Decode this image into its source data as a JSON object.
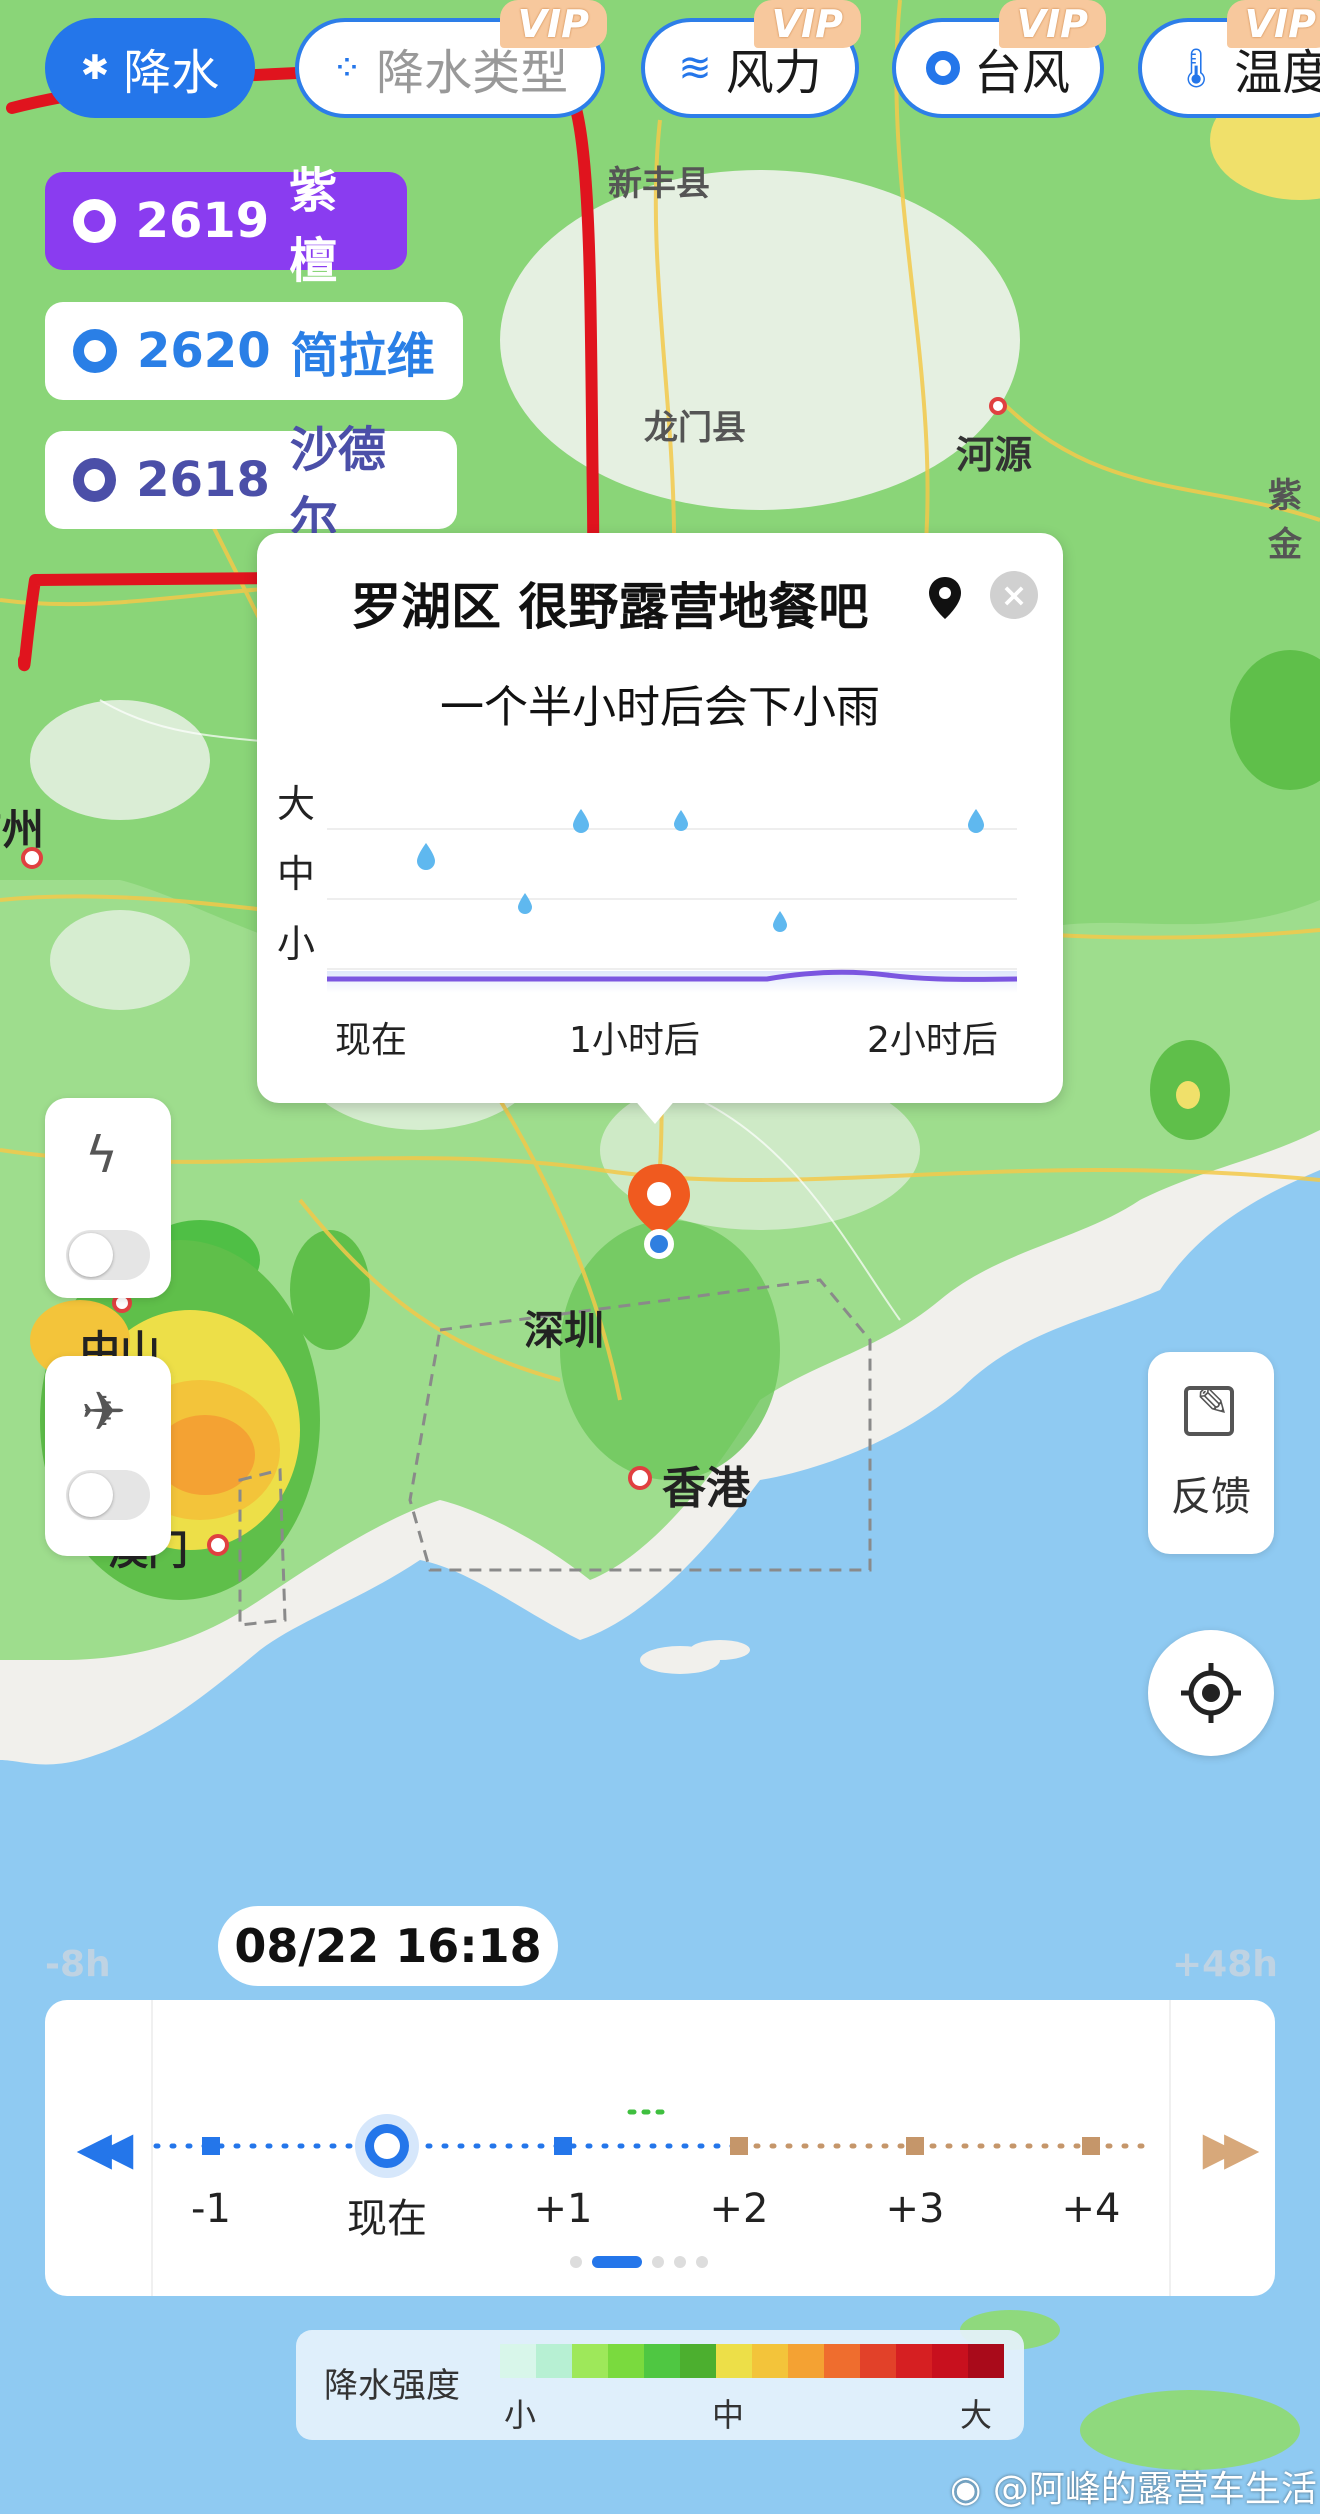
{
  "tabs": [
    {
      "label": "降水",
      "icon": "rain-icon",
      "active": true
    },
    {
      "label": "降水类型",
      "icon": "precip-type-icon",
      "vip": "VIP"
    },
    {
      "label": "风力",
      "icon": "wind-icon",
      "vip": "VIP"
    },
    {
      "label": "台风",
      "icon": "typhoon-icon",
      "vip": "VIP"
    },
    {
      "label": "温度",
      "icon": "thermometer-icon",
      "vip": "VIP"
    }
  ],
  "storms": [
    {
      "code": "2619",
      "name": "紫檀",
      "color": "#8a3cf0"
    },
    {
      "code": "2620",
      "name": "简拉维",
      "color": "#2a7fe6"
    },
    {
      "code": "2618",
      "name": "沙德尔",
      "color": "#4b4fa8"
    }
  ],
  "map_labels": {
    "xinfeng": "新丰县",
    "longmen": "龙门县",
    "heyuan": "河源",
    "zijin": "紫金",
    "guangzhou": "广州",
    "shenzhen": "深圳",
    "hongkong": "香港",
    "zhongshan": "中山",
    "macau": "澳门"
  },
  "popup": {
    "location": "罗湖区 很野露营地餐吧",
    "forecast": "一个半小时后会下小雨",
    "y_levels": [
      "大",
      "中",
      "小"
    ],
    "x_labels": [
      "现在",
      "1小时后",
      "2小时后"
    ]
  },
  "side": {
    "feedback_label": "反馈"
  },
  "timeline": {
    "current_time": "08/22 16:18",
    "range_start": "-8h",
    "range_end": "+48h",
    "ticks": [
      "-1",
      "现在",
      "+1",
      "+2",
      "+3",
      "+4"
    ],
    "page_index": 2,
    "page_count": 6
  },
  "legend": {
    "title": "降水强度",
    "low": "小",
    "mid": "中",
    "high": "大",
    "colors": [
      "#d8f6ea",
      "#b7f0d3",
      "#9ee85a",
      "#7ada3e",
      "#4fc742",
      "#4caf2f",
      "#eddf48",
      "#f3c43a",
      "#f4a233",
      "#ef6d2e",
      "#e24129",
      "#d61f22",
      "#c8101e",
      "#a90a1a"
    ]
  },
  "watermark": "@阿峰的露营车生活",
  "colors": {
    "accent": "#2476ea",
    "annotation": "#e0141e"
  }
}
